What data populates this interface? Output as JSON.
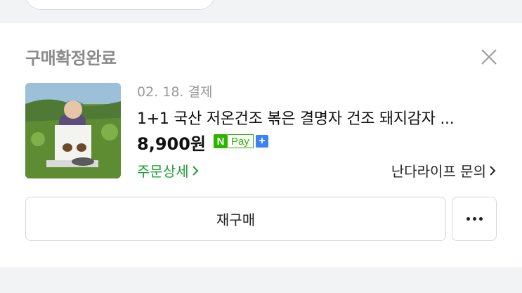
{
  "order": {
    "status": "구매확정완료",
    "date": "02. 18. 결제",
    "product_title": "1+1 국산 저온건조 볶은 결명자 건조 돼지감자 ...",
    "price": "8,900원",
    "npay": {
      "n": "N",
      "pay": "Pay",
      "plus": "+"
    },
    "order_detail_label": "주문상세",
    "seller_inquiry_label": "난다라이프 문의",
    "rebuy_label": "재구매"
  },
  "colors": {
    "accent_green": "#1fa037",
    "npay_green": "#2db400",
    "npay_plus_blue": "#3b82f6"
  },
  "icons": [
    "close-icon",
    "chevron-right-icon",
    "more-icon"
  ]
}
